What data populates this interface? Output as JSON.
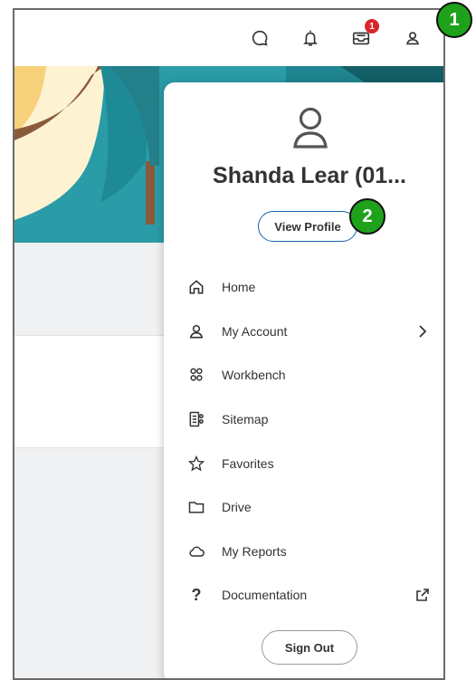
{
  "topbar": {
    "icons": [
      "chat-icon",
      "notifications-icon",
      "inbox-icon",
      "profile-icon"
    ],
    "inbox_badge": "1"
  },
  "profile_menu": {
    "user_name": "Shanda Lear (01...",
    "view_profile_label": "View Profile",
    "items": [
      {
        "label": "Home",
        "icon": "home-icon"
      },
      {
        "label": "My Account",
        "icon": "account-icon",
        "trailing": "chevron-right-icon"
      },
      {
        "label": "Workbench",
        "icon": "workbench-icon"
      },
      {
        "label": "Sitemap",
        "icon": "sitemap-icon"
      },
      {
        "label": "Favorites",
        "icon": "star-icon"
      },
      {
        "label": "Drive",
        "icon": "folder-icon"
      },
      {
        "label": "My Reports",
        "icon": "cloud-icon"
      },
      {
        "label": "Documentation",
        "icon": "question-icon",
        "trailing": "external-link-icon"
      }
    ],
    "sign_out_label": "Sign Out"
  },
  "callouts": [
    "1",
    "2"
  ],
  "colors": {
    "banner_teal": "#2a9ca7",
    "banner_cream": "#fdf2d2",
    "badge_red": "#d9262b",
    "button_border_blue": "#1a62ad",
    "callout_green": "#1fa11c"
  }
}
